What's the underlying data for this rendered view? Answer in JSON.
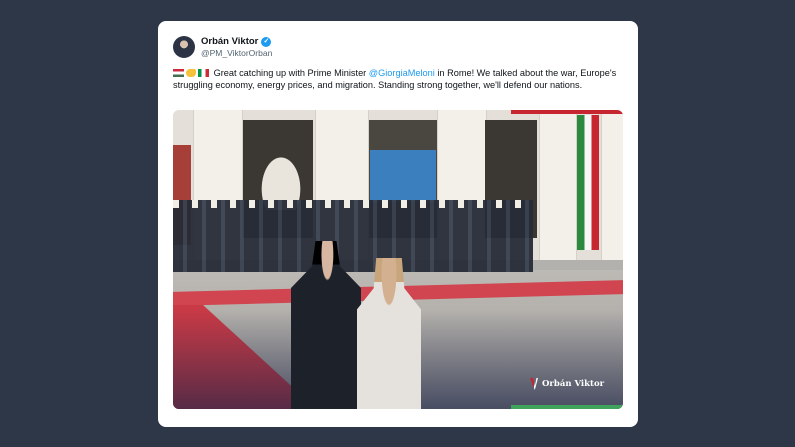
{
  "tweet": {
    "display_name": "Orbán Viktor",
    "handle": "@PM_ViktorOrban",
    "text_before": "Great catching up with Prime Minister ",
    "mention": "@GiorgiaMeloni",
    "text_after": " in Rome! We talked about the war, Europe's struggling economy, energy prices, and migration. Standing strong together, we'll defend our nations.",
    "verified_icon": "verified-badge-icon"
  },
  "photo": {
    "watermark_text": "Orbán Viktor"
  },
  "colors": {
    "background": "#2e3748",
    "card": "#ffffff",
    "link": "#1d9bf0",
    "verified": "#1d9bf0"
  }
}
